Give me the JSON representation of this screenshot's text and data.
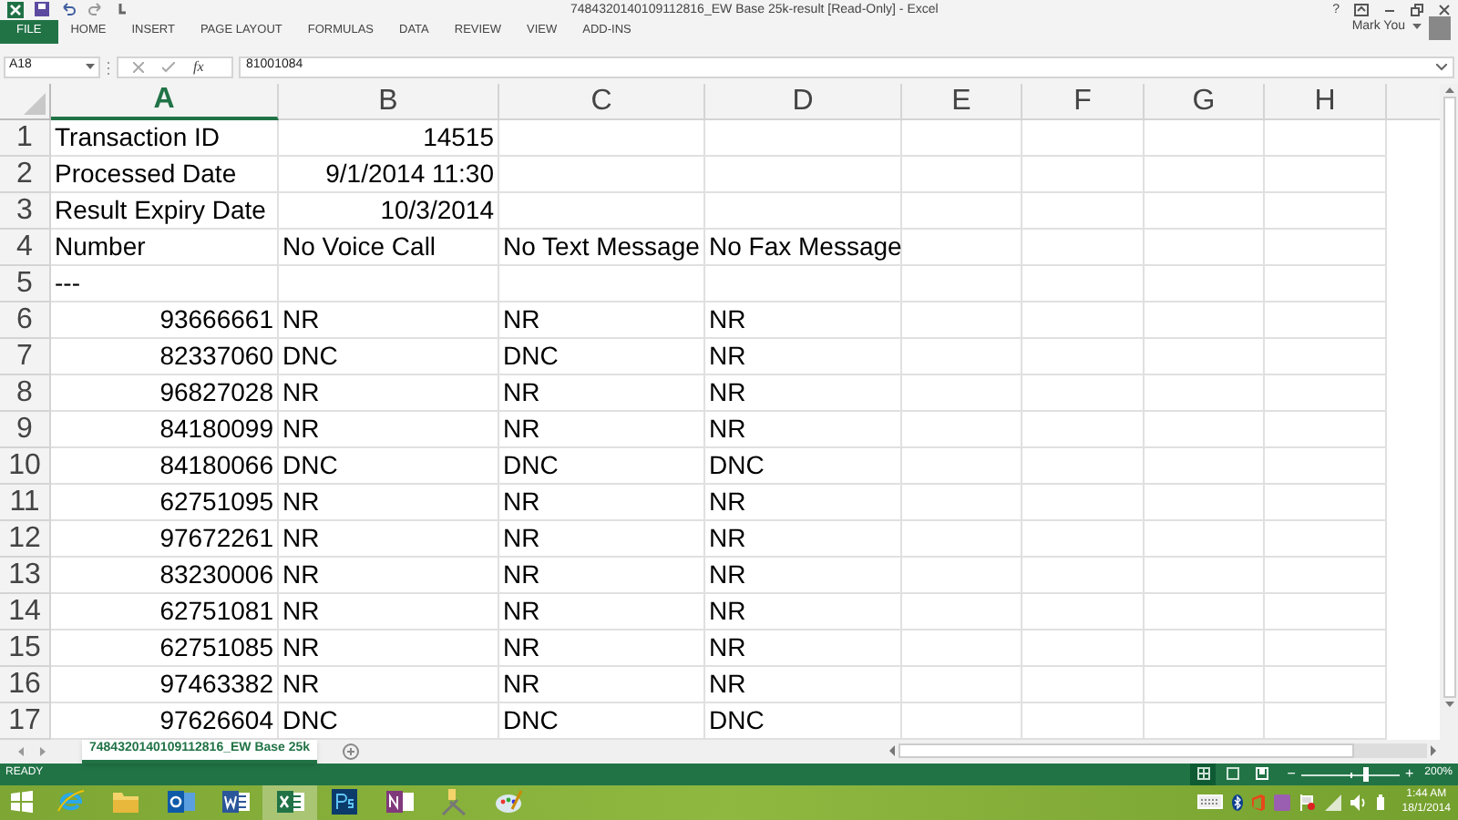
{
  "window": {
    "title": "7484320140109112816_EW Base 25k-result  [Read-Only] - Excel",
    "help": "?",
    "user": "Mark You"
  },
  "ribbon_tabs": [
    {
      "label": "FILE",
      "selected": true
    },
    {
      "label": "HOME",
      "selected": false
    },
    {
      "label": "INSERT",
      "selected": false
    },
    {
      "label": "PAGE LAYOUT",
      "selected": false
    },
    {
      "label": "FORMULAS",
      "selected": false
    },
    {
      "label": "DATA",
      "selected": false
    },
    {
      "label": "REVIEW",
      "selected": false
    },
    {
      "label": "VIEW",
      "selected": false
    },
    {
      "label": "ADD-INS",
      "selected": false
    }
  ],
  "formula_bar": {
    "name_box": "A18",
    "function_label": "fx",
    "value": "81001084"
  },
  "columns": [
    {
      "label": "A",
      "selected": true
    },
    {
      "label": "B",
      "selected": false
    },
    {
      "label": "C",
      "selected": false
    },
    {
      "label": "D",
      "selected": false
    },
    {
      "label": "E",
      "selected": false
    },
    {
      "label": "F",
      "selected": false
    },
    {
      "label": "G",
      "selected": false
    },
    {
      "label": "H",
      "selected": false
    }
  ],
  "rows": [
    {
      "number": "1",
      "cells": [
        {
          "text": "Transaction ID",
          "kind": "text"
        },
        {
          "text": "14515",
          "kind": "number"
        }
      ]
    },
    {
      "number": "2",
      "cells": [
        {
          "text": "Processed Date",
          "kind": "text"
        },
        {
          "text": "9/1/2014 11:30",
          "kind": "number"
        }
      ]
    },
    {
      "number": "3",
      "cells": [
        {
          "text": "Result Expiry Date",
          "kind": "text"
        },
        {
          "text": "10/3/2014",
          "kind": "number"
        }
      ]
    },
    {
      "number": "4",
      "cells": [
        {
          "text": "Number",
          "kind": "text"
        },
        {
          "text": "No Voice Call",
          "kind": "text"
        },
        {
          "text": "No Text Message",
          "kind": "text"
        },
        {
          "text": "No Fax Message",
          "kind": "text"
        }
      ]
    },
    {
      "number": "5",
      "cells": [
        {
          "text": "---",
          "kind": "text"
        }
      ]
    },
    {
      "number": "6",
      "cells": [
        {
          "text": "93666661",
          "kind": "number"
        },
        {
          "text": "NR",
          "kind": "text"
        },
        {
          "text": "NR",
          "kind": "text"
        },
        {
          "text": "NR",
          "kind": "text"
        }
      ]
    },
    {
      "number": "7",
      "cells": [
        {
          "text": "82337060",
          "kind": "number"
        },
        {
          "text": "DNC",
          "kind": "text"
        },
        {
          "text": "DNC",
          "kind": "text"
        },
        {
          "text": "NR",
          "kind": "text"
        }
      ]
    },
    {
      "number": "8",
      "cells": [
        {
          "text": "96827028",
          "kind": "number"
        },
        {
          "text": "NR",
          "kind": "text"
        },
        {
          "text": "NR",
          "kind": "text"
        },
        {
          "text": "NR",
          "kind": "text"
        }
      ]
    },
    {
      "number": "9",
      "cells": [
        {
          "text": "84180099",
          "kind": "number"
        },
        {
          "text": "NR",
          "kind": "text"
        },
        {
          "text": "NR",
          "kind": "text"
        },
        {
          "text": "NR",
          "kind": "text"
        }
      ]
    },
    {
      "number": "10",
      "cells": [
        {
          "text": "84180066",
          "kind": "number"
        },
        {
          "text": "DNC",
          "kind": "text"
        },
        {
          "text": "DNC",
          "kind": "text"
        },
        {
          "text": "DNC",
          "kind": "text"
        }
      ]
    },
    {
      "number": "11",
      "cells": [
        {
          "text": "62751095",
          "kind": "number"
        },
        {
          "text": "NR",
          "kind": "text"
        },
        {
          "text": "NR",
          "kind": "text"
        },
        {
          "text": "NR",
          "kind": "text"
        }
      ]
    },
    {
      "number": "12",
      "cells": [
        {
          "text": "97672261",
          "kind": "number"
        },
        {
          "text": "NR",
          "kind": "text"
        },
        {
          "text": "NR",
          "kind": "text"
        },
        {
          "text": "NR",
          "kind": "text"
        }
      ]
    },
    {
      "number": "13",
      "cells": [
        {
          "text": "83230006",
          "kind": "number"
        },
        {
          "text": "NR",
          "kind": "text"
        },
        {
          "text": "NR",
          "kind": "text"
        },
        {
          "text": "NR",
          "kind": "text"
        }
      ]
    },
    {
      "number": "14",
      "cells": [
        {
          "text": "62751081",
          "kind": "number"
        },
        {
          "text": "NR",
          "kind": "text"
        },
        {
          "text": "NR",
          "kind": "text"
        },
        {
          "text": "NR",
          "kind": "text"
        }
      ]
    },
    {
      "number": "15",
      "cells": [
        {
          "text": "62751085",
          "kind": "number"
        },
        {
          "text": "NR",
          "kind": "text"
        },
        {
          "text": "NR",
          "kind": "text"
        },
        {
          "text": "NR",
          "kind": "text"
        }
      ]
    },
    {
      "number": "16",
      "cells": [
        {
          "text": "97463382",
          "kind": "number"
        },
        {
          "text": "NR",
          "kind": "text"
        },
        {
          "text": "NR",
          "kind": "text"
        },
        {
          "text": "NR",
          "kind": "text"
        }
      ]
    },
    {
      "number": "17",
      "cells": [
        {
          "text": "97626604",
          "kind": "number"
        },
        {
          "text": "DNC",
          "kind": "text"
        },
        {
          "text": "DNC",
          "kind": "text"
        },
        {
          "text": "DNC",
          "kind": "text"
        }
      ]
    }
  ],
  "sheet_tabs": [
    {
      "label": "7484320140109112816_EW Base 25k",
      "selected": true
    }
  ],
  "status_bar": {
    "status": "READY",
    "zoom_out": "−",
    "zoom_in": "+",
    "zoom": "200%",
    "zoom_level": {
      "level": 0.67
    }
  },
  "taskbar": {
    "apps": [
      {
        "kind": "ie",
        "active": false
      },
      {
        "kind": "folder",
        "active": false
      },
      {
        "kind": "outlook",
        "active": false
      },
      {
        "kind": "word",
        "active": false
      },
      {
        "kind": "excel",
        "active": true
      },
      {
        "kind": "photoshop",
        "active": false
      },
      {
        "kind": "onenote",
        "active": false
      },
      {
        "kind": "tools",
        "active": false
      },
      {
        "kind": "paint",
        "active": false
      }
    ],
    "time": "1:44 AM",
    "date": "18/1/2014"
  }
}
